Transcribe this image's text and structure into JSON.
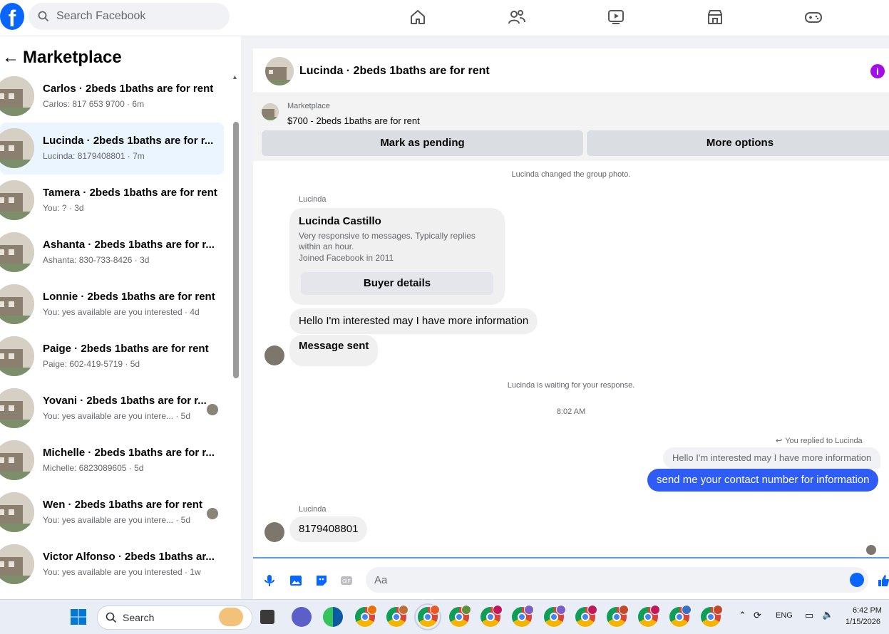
{
  "topbar": {
    "logo": "f",
    "search_placeholder": "Search Facebook",
    "nav_icons": [
      "home-icon",
      "friends-icon",
      "video-icon",
      "marketplace-icon",
      "gaming-icon"
    ]
  },
  "sidebar": {
    "back": "←",
    "title": "Marketplace",
    "conversations": [
      {
        "name": "Carlos · 2beds 1baths are for rent",
        "sub": "Carlos: 817 653 9700 · 6m"
      },
      {
        "name": "Lucinda · 2beds 1baths are for r...",
        "sub": "Lucinda: 8179408801 · 7m"
      },
      {
        "name": "Tamera · 2beds 1baths are for rent",
        "sub": "You: ? · 3d"
      },
      {
        "name": "Ashanta · 2beds 1baths are for r...",
        "sub": "Ashanta: 830-733-8426 · 3d"
      },
      {
        "name": "Lonnie · 2beds 1baths are for rent",
        "sub": "You: yes available are you interested · 4d"
      },
      {
        "name": "Paige · 2beds 1baths are for rent",
        "sub": "Paige: 602-419-5719 · 5d"
      },
      {
        "name": "Yovani · 2beds 1baths are for r...",
        "sub": "You: yes available are you intere... · 5d"
      },
      {
        "name": "Michelle · 2beds 1baths are for r...",
        "sub": "Michelle: 6823089605 · 5d"
      },
      {
        "name": "Wen · 2beds 1baths are for rent",
        "sub": "You: yes available are you intere... · 5d"
      },
      {
        "name": "Victor Alfonso · 2beds 1baths ar...",
        "sub": "You: yes available are you interested · 1w"
      }
    ]
  },
  "chat": {
    "title": "Lucinda · 2beds 1baths are for rent",
    "info_icon": "i",
    "listing": {
      "label": "Marketplace",
      "price_title": "$700 - 2beds 1baths are for rent",
      "mark_pending": "Mark as pending",
      "more_options": "More options"
    },
    "messages": {
      "system_photo": "Lucinda changed the group photo.",
      "sender1": "Lucinda",
      "profile_name": "Lucinda Castillo",
      "profile_desc": "Very responsive to messages. Typically replies within an hour.",
      "profile_joined": "Joined Facebook in 2011",
      "buyer_details": "Buyer details",
      "msg_interested": "Hello I'm interested may I have more information",
      "msg_sent": "Message sent",
      "system_waiting": "Lucinda is waiting for your response.",
      "time": "8:02 AM",
      "replied_to": "You replied to Lucinda",
      "quoted": "Hello I'm interested may I have more information",
      "my_reply": "send me your contact number for information",
      "sender2": "Lucinda",
      "msg_number": "8179408801"
    },
    "composer_placeholder": "Aa"
  },
  "taskbar": {
    "search_label": "Search",
    "lang": "ENG",
    "time": "6:42 PM",
    "date": "1/15/2026"
  },
  "colors": {
    "fb_blue": "#0866ff",
    "my_bubble": "#2f5cf5",
    "info_purple": "#a30ee8"
  }
}
